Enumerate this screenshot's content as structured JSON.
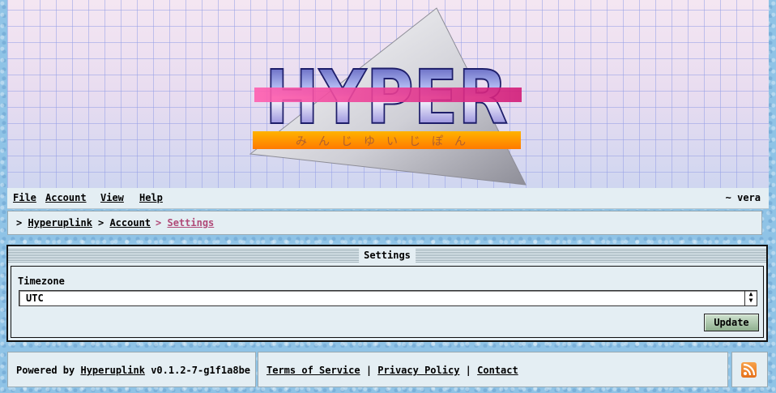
{
  "logo": {
    "wordmark": "HYPER",
    "subtitle": "みんじゆいじぽん"
  },
  "menubar": {
    "items": [
      "File",
      "Account",
      "View",
      "Help"
    ],
    "user": "~ vera"
  },
  "breadcrumb": {
    "items": [
      "Hyperuplink",
      "Account"
    ],
    "current": "Settings"
  },
  "panel": {
    "title": "Settings",
    "timezone_label": "Timezone",
    "timezone_value": "UTC",
    "update_label": "Update"
  },
  "footer": {
    "powered_prefix": "Powered by",
    "powered_name": "Hyperuplink",
    "version": "v0.1.2-7-g1f1a8be",
    "links": [
      "Terms of Service",
      "Privacy Policy",
      "Contact"
    ]
  },
  "colors": {
    "accent": "#b04a78",
    "button": "#8fb08f",
    "rss": "#e5701a"
  },
  "icons": {
    "rss": "rss-icon",
    "select_arrows": "select-arrows-icon"
  }
}
